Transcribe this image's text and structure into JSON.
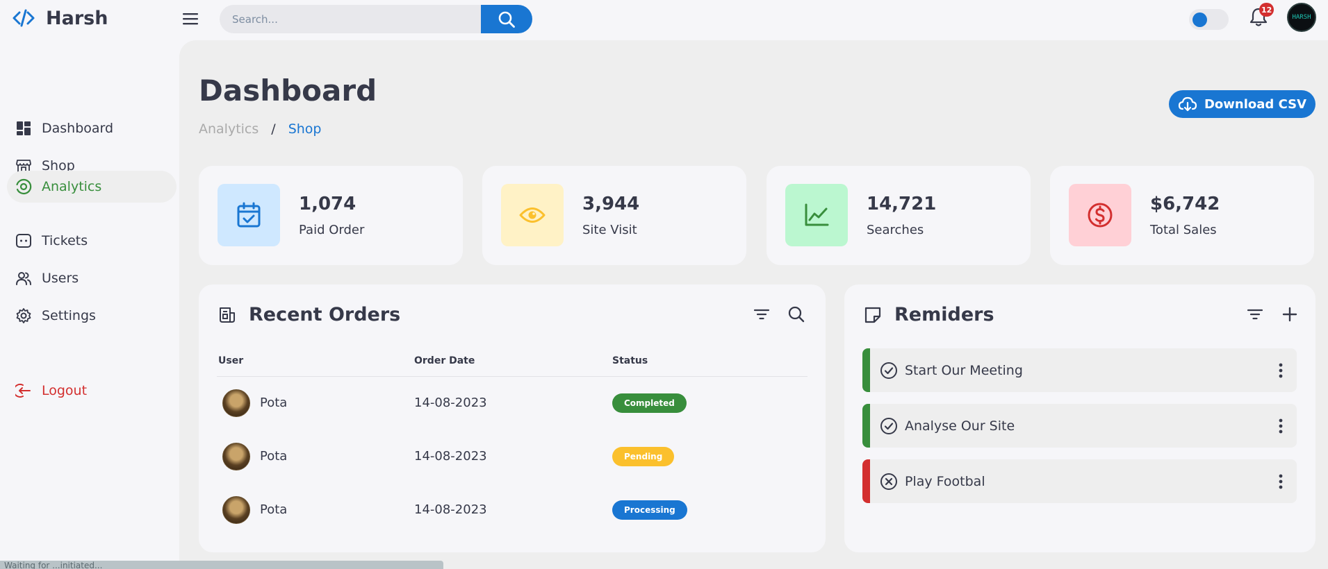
{
  "header": {
    "brand": "Harsh",
    "search_placeholder": "Search...",
    "notification_count": "12",
    "profile_label": "HARSH"
  },
  "sidebar": {
    "items": [
      {
        "label": "Dashboard",
        "icon": "dashboard-icon"
      },
      {
        "label": "Shop",
        "icon": "shop-icon"
      },
      {
        "label": "Analytics",
        "icon": "analytics-icon",
        "active": true
      },
      {
        "label": "Tickets",
        "icon": "ticket-icon"
      },
      {
        "label": "Users",
        "icon": "users-icon"
      },
      {
        "label": "Settings",
        "icon": "gear-icon"
      }
    ],
    "logout": "Logout"
  },
  "main": {
    "title": "Dashboard",
    "breadcrumb": [
      "Analytics",
      "/",
      "Shop"
    ],
    "download_label": "Download CSV",
    "stats": [
      {
        "value": "1,074",
        "label": "Paid Order",
        "icon": "calendar-check-icon",
        "bg": "#cfe8ff",
        "fg": "#1976d2"
      },
      {
        "value": "3,944",
        "label": "Site Visit",
        "icon": "eye-icon",
        "bg": "#fff2c6",
        "fg": "#fbc02d"
      },
      {
        "value": "14,721",
        "label": "Searches",
        "icon": "line-chart-icon",
        "bg": "#bbf7d0",
        "fg": "#388e3c"
      },
      {
        "value": "$6,742",
        "label": "Total Sales",
        "icon": "dollar-circle-icon",
        "bg": "#ffd0d6",
        "fg": "#d32f2f"
      }
    ],
    "orders": {
      "title": "Recent Orders",
      "columns": [
        "User",
        "Order Date",
        "Status"
      ],
      "rows": [
        {
          "user": "Pota",
          "date": "14-08-2023",
          "status": "Completed",
          "color": "#388e3c"
        },
        {
          "user": "Pota",
          "date": "14-08-2023",
          "status": "Pending",
          "color": "#fbc02d"
        },
        {
          "user": "Pota",
          "date": "14-08-2023",
          "status": "Processing",
          "color": "#1976d2"
        }
      ]
    },
    "reminders": {
      "title": "Remiders",
      "items": [
        {
          "text": "Start Our Meeting",
          "state": "done",
          "color": "#388e3c"
        },
        {
          "text": "Analyse Our Site",
          "state": "done",
          "color": "#388e3c"
        },
        {
          "text": "Play Footbal",
          "state": "cancelled",
          "color": "#d32f2f"
        }
      ]
    }
  },
  "status_bar": "Waiting for ...initiated..."
}
